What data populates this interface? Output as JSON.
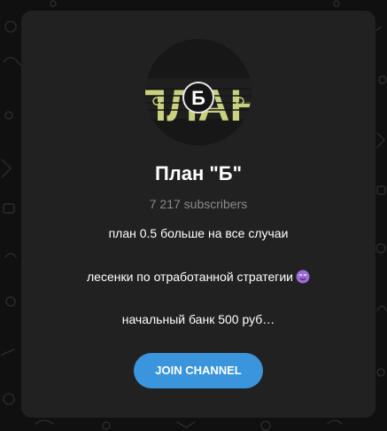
{
  "channel": {
    "avatar_text": "ПЛАН",
    "avatar_badge": "Б",
    "name": "План \"Б\"",
    "subscribers": "7 217 subscribers",
    "description": [
      "план 0.5 больше на все случаи",
      "лесенки по отработанной стратегии",
      "начальный банк 500 руб…"
    ],
    "description_emoji": "smiling-face-emoji",
    "join_label": "JOIN CHANNEL"
  },
  "colors": {
    "background": "#101010",
    "card": "#212121",
    "accent": "#3a95dd",
    "avatar_letters": "#c9d07e",
    "muted_text": "#8a8a8a"
  }
}
